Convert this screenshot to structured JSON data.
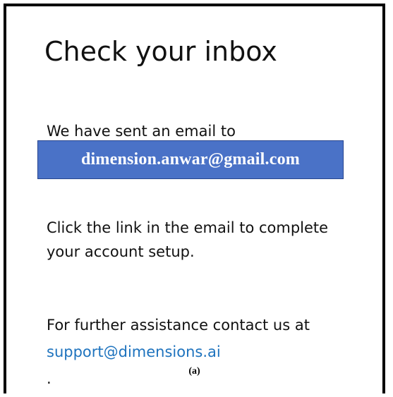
{
  "screen": {
    "title": "Check your inbox",
    "sent_text": "We have sent an email to",
    "email": "dimension.anwar@gmail.com",
    "instructions_line1": "Click the link in the email to complete",
    "instructions_line2": "your account setup.",
    "assistance_text": "For further assistance contact us at",
    "support_email": "support@dimensions.ai",
    "support_suffix": "."
  },
  "caption": "(a)",
  "colors": {
    "email_box_fill": "#4a72c7",
    "email_box_border": "#28468f",
    "link": "#1e73be",
    "text": "#111111"
  }
}
